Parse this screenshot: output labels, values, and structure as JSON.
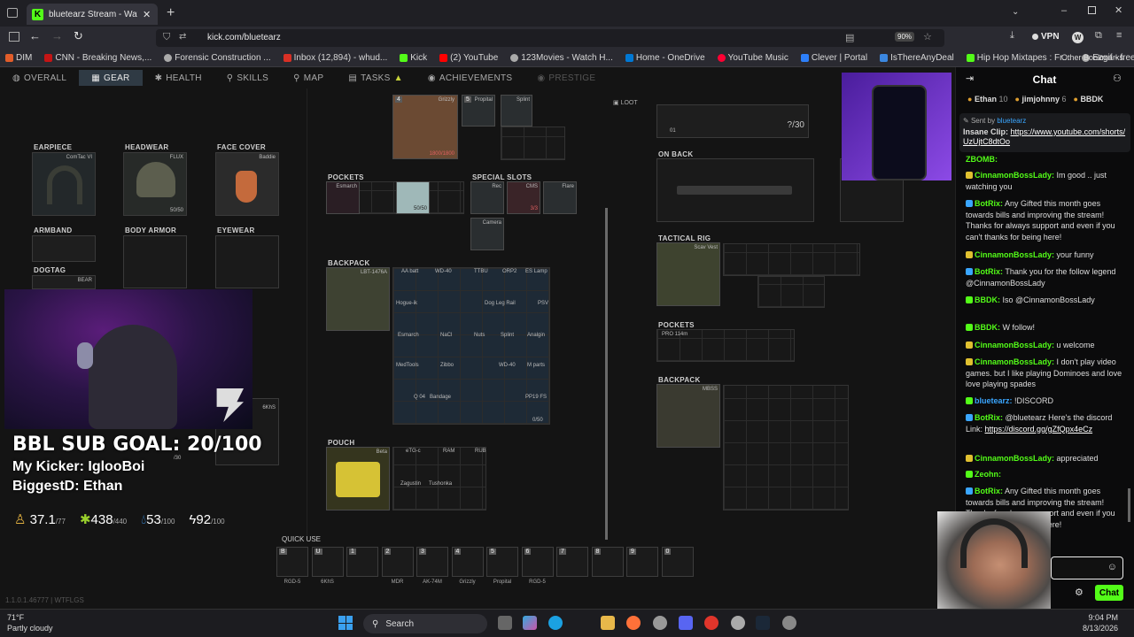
{
  "browser": {
    "tab_title": "bluetearz Stream - Watch L",
    "url": "kick.com/bluetearz",
    "zoom": "90%",
    "vpn": "VPN",
    "bookmarks": [
      "DIM",
      "CNN - Breaking News,...",
      "Forensic Construction ...",
      "Inbox (12,894) - whud...",
      "Kick",
      "(2) YouTube",
      "123Movies - Watch H...",
      "Home - OneDrive",
      "YouTube Music",
      "Clever | Portal",
      "IsThereAnyDeal",
      "Hip Hop Mixtapes : Fr...",
      "Ezgif - free online ani..."
    ],
    "other_bookmarks": "Other Bookmarks"
  },
  "game": {
    "tabs": [
      "OVERALL",
      "GEAR",
      "HEALTH",
      "SKILLS",
      "MAP",
      "TASKS",
      "ACHIEVEMENTS",
      "PRESTIGE"
    ],
    "active_tab": "GEAR",
    "slots": {
      "earpiece": {
        "label": "EARPIECE",
        "item": "ComTac VI"
      },
      "headwear": {
        "label": "HEADWEAR",
        "item": "FLUX",
        "dur": "50/50"
      },
      "face_cover": {
        "label": "FACE COVER",
        "item": "Baddie"
      },
      "armband": {
        "label": "ARMBAND"
      },
      "body_armor": {
        "label": "BODY ARMOR"
      },
      "eyewear": {
        "label": "EYEWEAR"
      },
      "dogtag": {
        "label": "DOGTAG",
        "item": "BEAR"
      }
    },
    "pockets": {
      "label": "POCKETS",
      "items": [
        "Esmarch",
        "",
        "50/50"
      ]
    },
    "special_slots": {
      "label": "SPECIAL SLOTS",
      "items": [
        "Rec",
        "CMS",
        "Flare",
        "Camera"
      ],
      "cms": "3/3"
    },
    "backpack": {
      "label": "BACKPACK",
      "item": "LBT-1476A",
      "items": [
        "AA batt",
        "WD-40",
        "TTBU",
        "ORP2",
        "ES Lamp",
        "Hogue-ik",
        "Dog Leg Rail",
        "PSV",
        "Esmarch",
        "NaCl",
        "Nuts",
        "Splint",
        "Analgin",
        "MedTools",
        "Zibbo",
        "WD-40",
        "M parts",
        "Q 04",
        "Bandage",
        "PP19 FS"
      ],
      "count": "0/50"
    },
    "pouch": {
      "label": "POUCH",
      "item": "Beta",
      "items": [
        "eTG-c",
        "RAM",
        "RUB",
        "Zagustin",
        "Tushonka"
      ]
    },
    "top_items": {
      "grizzly": "Grizzly",
      "propital": "Propital",
      "splint": "Splint",
      "grizzly_dur": "1800/1800",
      "q": "4",
      "q2": "5"
    },
    "loot": {
      "label": "LOOT",
      "ammo": "?/30",
      "count": "01"
    },
    "on_back": {
      "label": "ON BACK"
    },
    "tactical_rig": {
      "label": "TACTICAL RIG",
      "item": "Scav Vest"
    },
    "loot_pockets": {
      "label": "POCKETS",
      "item": "PRO 114m"
    },
    "loot_backpack": {
      "label": "BACKPACK",
      "item": "MBSS"
    },
    "misc": {
      "ammo30": "/30",
      "sixkhs": "6KhS"
    },
    "quick_use": {
      "label": "QUICK USE",
      "slots": [
        {
          "key": "B",
          "name": "RGD-5"
        },
        {
          "key": "U",
          "name": "6KhS"
        },
        {
          "key": "1",
          "name": ""
        },
        {
          "key": "2",
          "name": "MDR"
        },
        {
          "key": "3",
          "name": "AK-74M"
        },
        {
          "key": "4",
          "name": "Grizzly"
        },
        {
          "key": "5",
          "name": "Propital"
        },
        {
          "key": "6",
          "name": "RGD-5"
        },
        {
          "key": "7",
          "name": ""
        },
        {
          "key": "8",
          "name": ""
        },
        {
          "key": "9",
          "name": ""
        },
        {
          "key": "0",
          "name": ""
        }
      ]
    },
    "version": "1.1.0.1.46777 | WTFLGS"
  },
  "overlay": {
    "sub_goal": "BBL SUB GOAL: 20/100",
    "kicker": "My Kicker: IglooBoi",
    "biggest": "BiggestD: Ethan"
  },
  "stats": [
    {
      "icon": "energy-icon",
      "value": "37.1",
      "max": "/77"
    },
    {
      "icon": "weight-icon",
      "value": "438",
      "max": "/440"
    },
    {
      "icon": "water-icon",
      "value": "53",
      "max": "/100"
    },
    {
      "icon": "lightning-icon",
      "value": "92",
      "max": "/100"
    }
  ],
  "chat": {
    "title": "Chat",
    "top_gifters": [
      {
        "name": "Ethan",
        "count": "10"
      },
      {
        "name": "jimjohnny",
        "count": "6"
      },
      {
        "name": "BBDK",
        "count": ""
      }
    ],
    "pinned": {
      "sent_by_label": "Sent by",
      "sent_by": "bluetearz",
      "title": "Insane Clip:",
      "link": "https://www.youtube.com/shorts/UzUjtC8dtOo"
    },
    "messages": [
      {
        "user": "ZBOMB:",
        "text": "",
        "color": "#53fc18"
      },
      {
        "user": "CinnamonBossLady:",
        "text": "Im good .. just watching you",
        "color": "#53fc18"
      },
      {
        "user": "BotRix:",
        "text": "Any Gifted this month goes towards bills and improving the stream! Thanks for always support and even if you can't thanks for being here!",
        "color": "#53fc18"
      },
      {
        "user": "CinnamonBossLady:",
        "text": "your funny",
        "color": "#53fc18"
      },
      {
        "user": "BotRix:",
        "text": "Thank you for the follow legend @CinnamonBossLady",
        "color": "#53fc18"
      },
      {
        "user": "BBDK:",
        "text": "Iso @CinnamonBossLady",
        "color": "#53fc18"
      },
      {
        "user": "BBDK:",
        "text": "W follow!",
        "color": "#53fc18"
      },
      {
        "user": "CinnamonBossLady:",
        "text": "u welcome",
        "color": "#53fc18"
      },
      {
        "user": "CinnamonBossLady:",
        "text": "I don't play video games. but I like playing Dominoes and love love playing spades",
        "color": "#53fc18"
      },
      {
        "user": "bluetearz:",
        "text": "!DISCORD",
        "color": "#3aa6ff"
      },
      {
        "user": "BotRix:",
        "text": "@bluetearz Here's the discord Link:",
        "link": "https://discord.gg/gZfQpx4eCz",
        "color": "#53fc18"
      },
      {
        "user": "CinnamonBossLady:",
        "text": "appreciated",
        "color": "#53fc18"
      },
      {
        "user": "Zeohn:",
        "text": "",
        "color": "#53fc18"
      },
      {
        "user": "BotRix:",
        "text": "Any Gifted this month goes towards bills and improving the stream! Thanks for always support and even if you can't thanks for being here!",
        "color": "#53fc18"
      }
    ],
    "chat_button": "Chat"
  },
  "taskbar": {
    "weather_temp": "71°F",
    "weather_desc": "Partly cloudy",
    "search": "Search",
    "time": "9:04 PM",
    "date": "8/13/2026"
  }
}
